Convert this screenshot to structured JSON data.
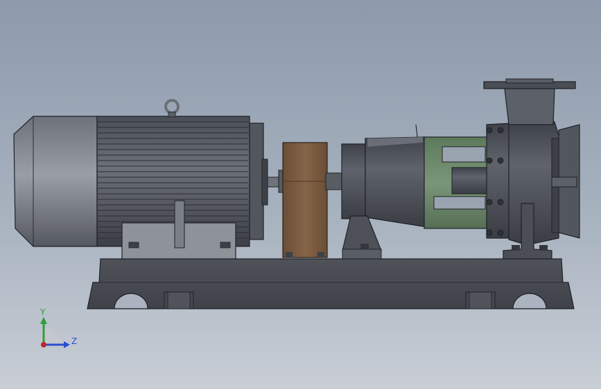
{
  "triad": {
    "y_label": "Y",
    "z_label": "Z",
    "y_color": "#2f9d3a",
    "z_color": "#2a4fd0",
    "x_color": "#c0262a"
  },
  "colors": {
    "metal": "#5a5e66",
    "metal_dark": "#33363c",
    "motor_cap": "#7a7e86",
    "coupling_guard": "#7a5a40",
    "bearing_frame": "#6b8a6a",
    "pump_casing": "#4f535b"
  }
}
